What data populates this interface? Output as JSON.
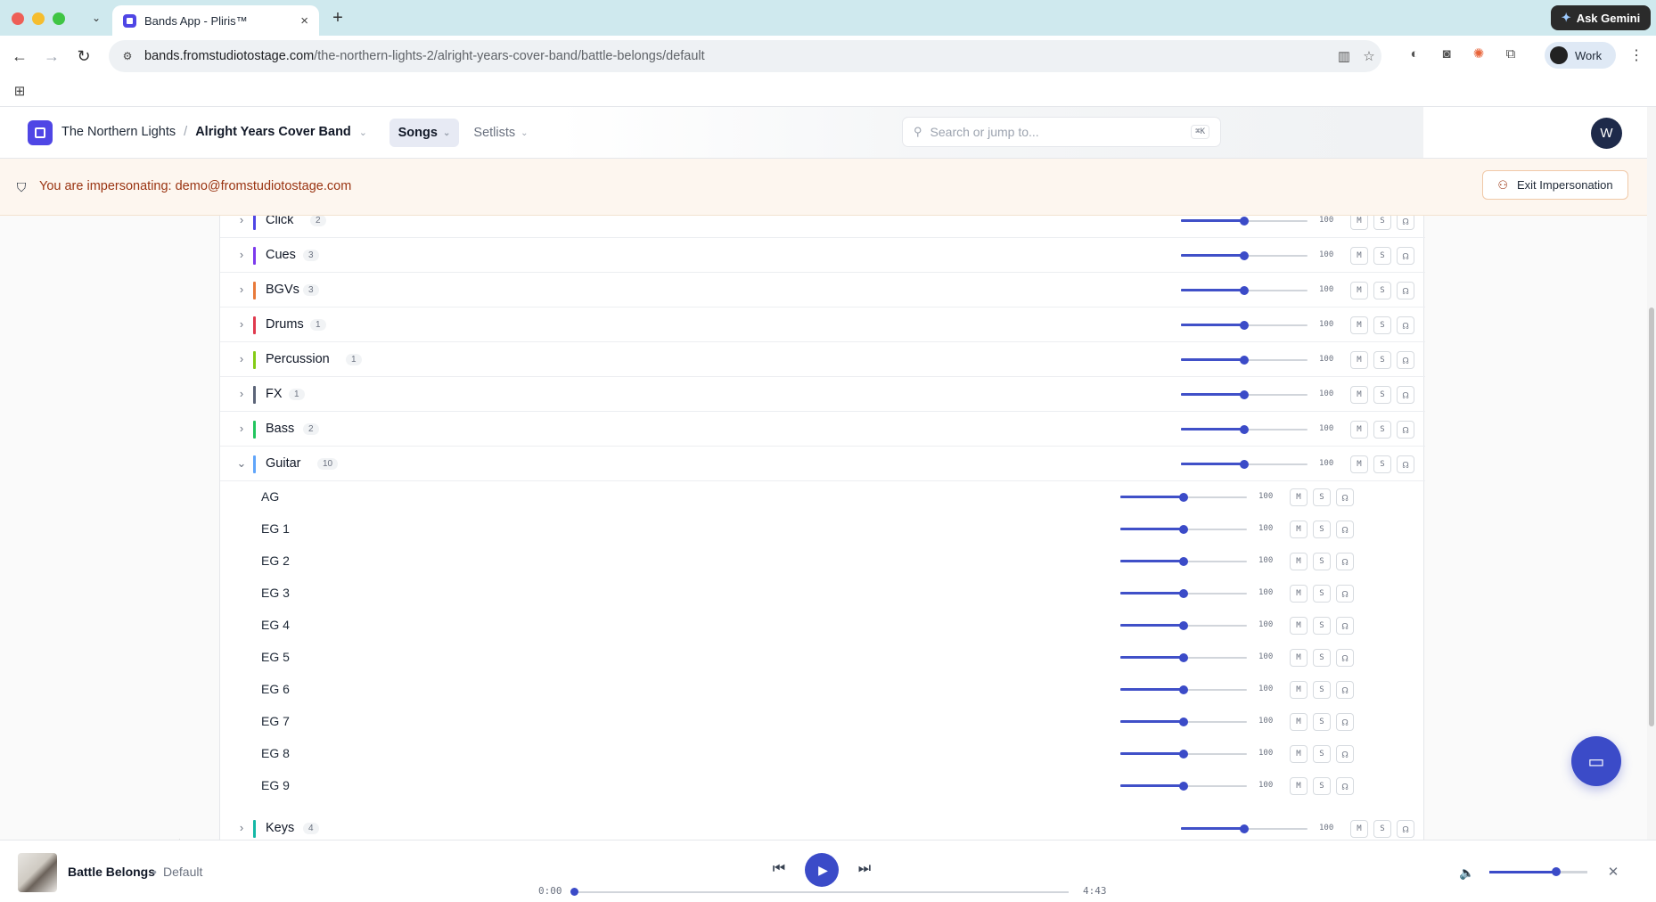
{
  "browser": {
    "tab_title": "Bands App - Pliris™",
    "tab_close": "×",
    "new_tab": "+",
    "url_host": "bands.fromstudiotostage.com",
    "url_path": "/the-northern-lights-2/alright-years-cover-band/battle-belongs/default",
    "ask_gemini": "Ask Gemini",
    "profile_label": "Work"
  },
  "header": {
    "band": "The Northern Lights",
    "separator": "/",
    "project": "Alright Years Cover Band",
    "nav_songs": "Songs",
    "nav_setlists": "Setlists",
    "search_placeholder": "Search or jump to...",
    "search_shortcut": "⌘K",
    "avatar_initial": "W"
  },
  "banner": {
    "text": "You are impersonating: demo@fromstudiotostage.com",
    "exit_label": "Exit Impersonation"
  },
  "mixer": {
    "button_mute": "M",
    "button_solo": "S",
    "groups_before": [
      {
        "name": "Click",
        "count": "2",
        "volume": "100",
        "level": 0.5,
        "color": "#4f46e5"
      },
      {
        "name": "Cues",
        "count": "3",
        "volume": "100",
        "level": 0.5,
        "color": "#7c3aed"
      },
      {
        "name": "BGVs",
        "count": "3",
        "volume": "100",
        "level": 0.5,
        "color": "#e87a3a"
      },
      {
        "name": "Drums",
        "count": "1",
        "volume": "100",
        "level": 0.5,
        "color": "#e03a4e"
      },
      {
        "name": "Percussion",
        "count": "1",
        "volume": "100",
        "level": 0.5,
        "color": "#84cc16"
      },
      {
        "name": "FX",
        "count": "1",
        "volume": "100",
        "level": 0.5,
        "color": "#5b6478"
      },
      {
        "name": "Bass",
        "count": "2",
        "volume": "100",
        "level": 0.5,
        "color": "#22c55e"
      }
    ],
    "guitar": {
      "name": "Guitar",
      "count": "10",
      "volume": "100",
      "level": 0.5,
      "color": "#60a5fa"
    },
    "guitar_tracks": [
      {
        "name": "AG",
        "volume": "100",
        "level": 0.5
      },
      {
        "name": "EG 1",
        "volume": "100",
        "level": 0.5
      },
      {
        "name": "EG 2",
        "volume": "100",
        "level": 0.5
      },
      {
        "name": "EG 3",
        "volume": "100",
        "level": 0.5
      },
      {
        "name": "EG 4",
        "volume": "100",
        "level": 0.5
      },
      {
        "name": "EG 5",
        "volume": "100",
        "level": 0.5
      },
      {
        "name": "EG 6",
        "volume": "100",
        "level": 0.5
      },
      {
        "name": "EG 7",
        "volume": "100",
        "level": 0.5
      },
      {
        "name": "EG 8",
        "volume": "100",
        "level": 0.5
      },
      {
        "name": "EG 9",
        "volume": "100",
        "level": 0.5
      }
    ],
    "keys": {
      "name": "Keys",
      "count": "4",
      "volume": "100",
      "level": 0.5,
      "color": "#14b8a6"
    }
  },
  "player": {
    "title": "Battle Belongs",
    "dot": "•",
    "version": "Default",
    "time_current": "0:00",
    "time_total": "4:43",
    "progress": 0,
    "master_level": 0.68
  },
  "colors": {
    "accent": "#3b4bc8",
    "banner_text": "#9a3412"
  }
}
